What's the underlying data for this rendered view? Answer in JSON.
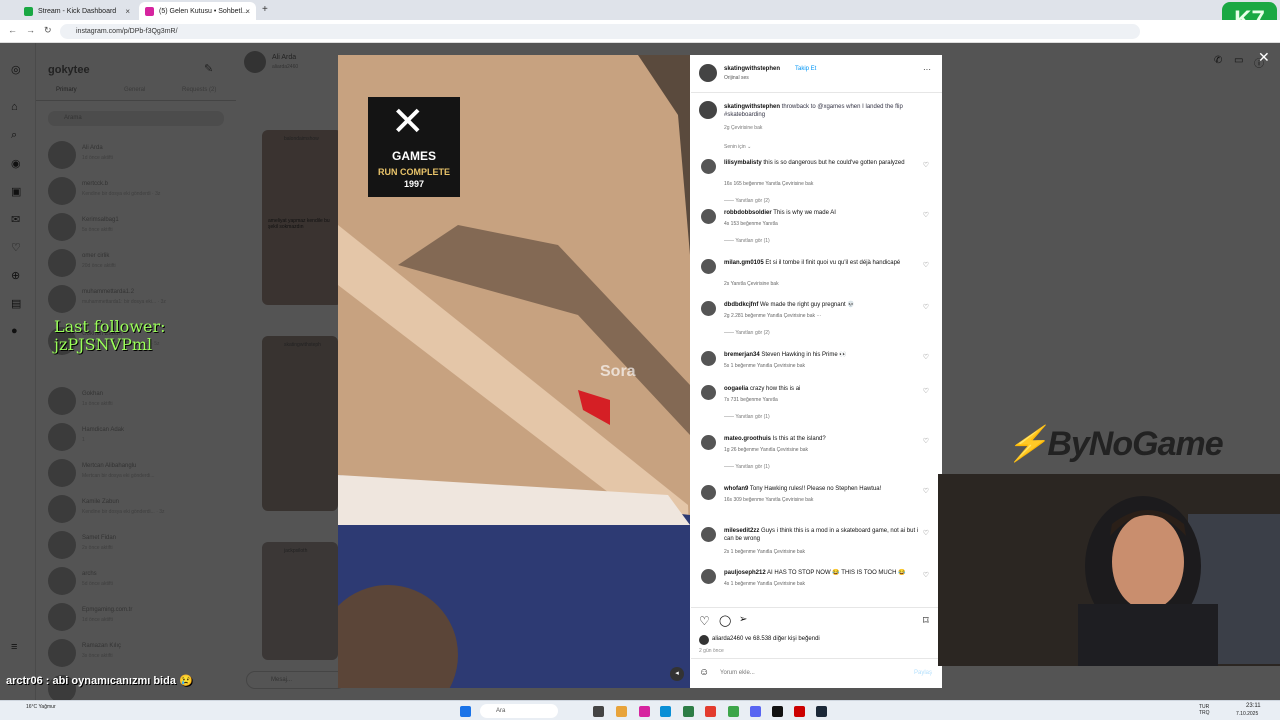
{
  "browser": {
    "tabs": [
      {
        "label": "Stream - Kick Dashboard",
        "color": "#1aa843"
      },
      {
        "label": "(5) Gelen Kutusu • Sohbetl...",
        "color": "#d6249f"
      }
    ],
    "url": "instagram.com/p/DPb-f3Qg3mR/",
    "new_tab": "+",
    "close": "×"
  },
  "ig": {
    "username": "gokytee",
    "dm_tabs": [
      "Primary",
      "General",
      "Requests (2)"
    ],
    "search_placeholder": "Arama",
    "chats": [
      {
        "name": "Ali Arda",
        "sub": "1d önce aktifti"
      },
      {
        "name": "mertcck.b",
        "sub": "Kendine bir dosya eki gönderdi · 3z"
      },
      {
        "name": "Kerimsalbag1",
        "sub": "5s önce aktifti"
      },
      {
        "name": "omer cirlik",
        "sub": "20d önce aktifti"
      },
      {
        "name": "muhammettarda1.2",
        "sub": "muhammettarda1: bir dosya eki... · 3z"
      },
      {
        "name": "Gokhan Zabun",
        "sub": "Gokhan bir dosya eki gönderdi · 5z"
      },
      {
        "name": "Gokhan",
        "sub": "1s önce aktifti"
      },
      {
        "name": "Hamdican Adak",
        "sub": "1"
      },
      {
        "name": "Mertcan Alibahanglu",
        "sub": "Mertcan bir dosya eki gönderdi..."
      },
      {
        "name": "Kamile Zabun",
        "sub": "Kendine bir dosya eki gönderdi... · 3z"
      },
      {
        "name": "Samet Fidan",
        "sub": "2s önce aktifti"
      },
      {
        "name": "archs",
        "sub": "5d önce aktifti"
      },
      {
        "name": "Epmgaming.com.tr",
        "sub": "1d önce aktifti"
      },
      {
        "name": "Ramazan Kılıç",
        "sub": "3s önce aktifti"
      },
      {
        "name": "Ali Mert Can",
        "sub": ""
      }
    ],
    "chat_header": {
      "name": "Ali Arda",
      "sub": "aliarda2460"
    },
    "thread_cards": [
      "balondaimshow",
      "skatingwithsteph",
      "jackpsiloth"
    ],
    "thread_overlay": "ameliyat yapmaz kendile bu şekil sokmazdın",
    "message_placeholder": "Mesaj..."
  },
  "post": {
    "author": "skatingwithstephen",
    "follow": "Takip Et",
    "audio": "Orijinal ses",
    "more": "···",
    "caption_user": "skatingwithstephen",
    "caption": "throwback to @xgames when I landed the flip #skateboarding",
    "caption_meta": "2g    Çevirisine bak",
    "for_you": "Senin için ⌄",
    "video_badge_title": "GAMES",
    "video_badge_sub": "RUN COMPLETE",
    "video_badge_year": "1997",
    "watermark": "Sora",
    "comments": [
      {
        "user": "lilisymbalisty",
        "text": "this is so dangerous but he could've gotten paralyzed",
        "meta": "16s   165 beğenme   Yanıtla   Çevirisine bak",
        "replies": "Yanıtları gör (2)"
      },
      {
        "user": "robbdobbsoldier",
        "text": "This is why we made AI",
        "meta": "4s   153 beğenme   Yanıtla",
        "replies": "Yanıtları gör (1)"
      },
      {
        "user": "milan.gm0105",
        "text": "Et si il tombe il finit quoi vu qu'il est déjà handicapé",
        "meta": "2s   Yanıtla   Çevirisine bak",
        "replies": ""
      },
      {
        "user": "dbdbdkcjfnf",
        "text": "We made the right guy pregnant 💀",
        "meta": "2g   2.281 beğenme   Yanıtla   Çevirisine bak  ···",
        "replies": "Yanıtları gör (2)"
      },
      {
        "user": "bremerjan34",
        "text": "Steven Hawking in his Prime 👀",
        "meta": "5s   1 beğenme   Yanıtla   Çevirisine bak",
        "replies": ""
      },
      {
        "user": "oogaelia",
        "text": "crazy how this is ai",
        "meta": "7s   731 beğenme   Yanıtla",
        "replies": "Yanıtları gör (1)"
      },
      {
        "user": "mateo.groothuis",
        "text": "Is this at the island?",
        "meta": "1g   26 beğenme   Yanıtla   Çevirisine bak",
        "replies": "Yanıtları gör (1)"
      },
      {
        "user": "whofan9",
        "text": "Tony Hawking rules!! Please no Stephen Hawtua!",
        "meta": "16s   309 beğenme   Yanıtla   Çevirisine bak",
        "replies": ""
      },
      {
        "user": "milesedit2zz",
        "text": "Guys i think this is a mod in a skateboard game, not ai but i can be wrong",
        "meta": "2s   1 beğenme   Yanıtla   Çevirisine bak",
        "replies": ""
      },
      {
        "user": "pauljoseph212",
        "text": "AI HAS TO STOP NOW 😂 THIS IS TOO MUCH 😂",
        "meta": "4s   1 beğenme   Yanıtla   Çevirisine bak",
        "replies": ""
      }
    ],
    "likes": "aliarda2460 ve 68.538 diğer kişi beğendi",
    "date": "2 gün önce",
    "comment_placeholder": "Yorum ekle...",
    "post_button": "Paylaş"
  },
  "overlay": {
    "follower": "Last follower:\njzPJSNVPml",
    "chat_msg": "arctr06 : abi oynamıcanızmı bida 😢",
    "brand": "ByNoGame",
    "kick_badge": "K7"
  },
  "taskbar": {
    "weather": "16°C Yağmur",
    "search": "Ara",
    "lang": "TUR TRQ",
    "time": "23:11",
    "date": "7.10.2025"
  }
}
